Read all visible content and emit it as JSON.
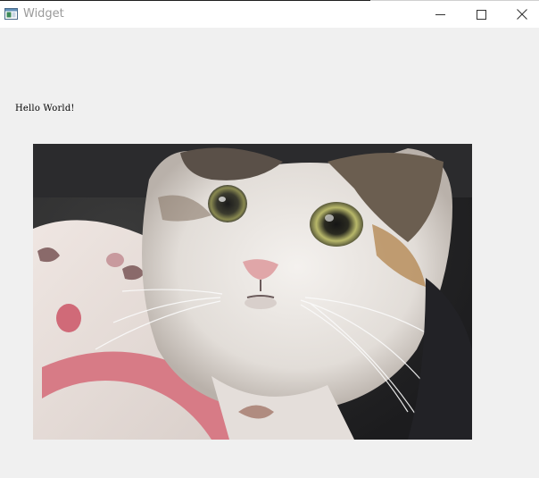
{
  "window": {
    "title": "Widget",
    "controls": {
      "minimize_icon": "minimize-icon",
      "maximize_icon": "maximize-icon",
      "close_icon": "close-icon"
    }
  },
  "content": {
    "label_text": "Hello World!",
    "image_subject": "calico cat"
  },
  "colors": {
    "window_bg": "#f0f0f0",
    "titlebar_bg": "#ffffff",
    "title_text": "#9a9a9a"
  }
}
